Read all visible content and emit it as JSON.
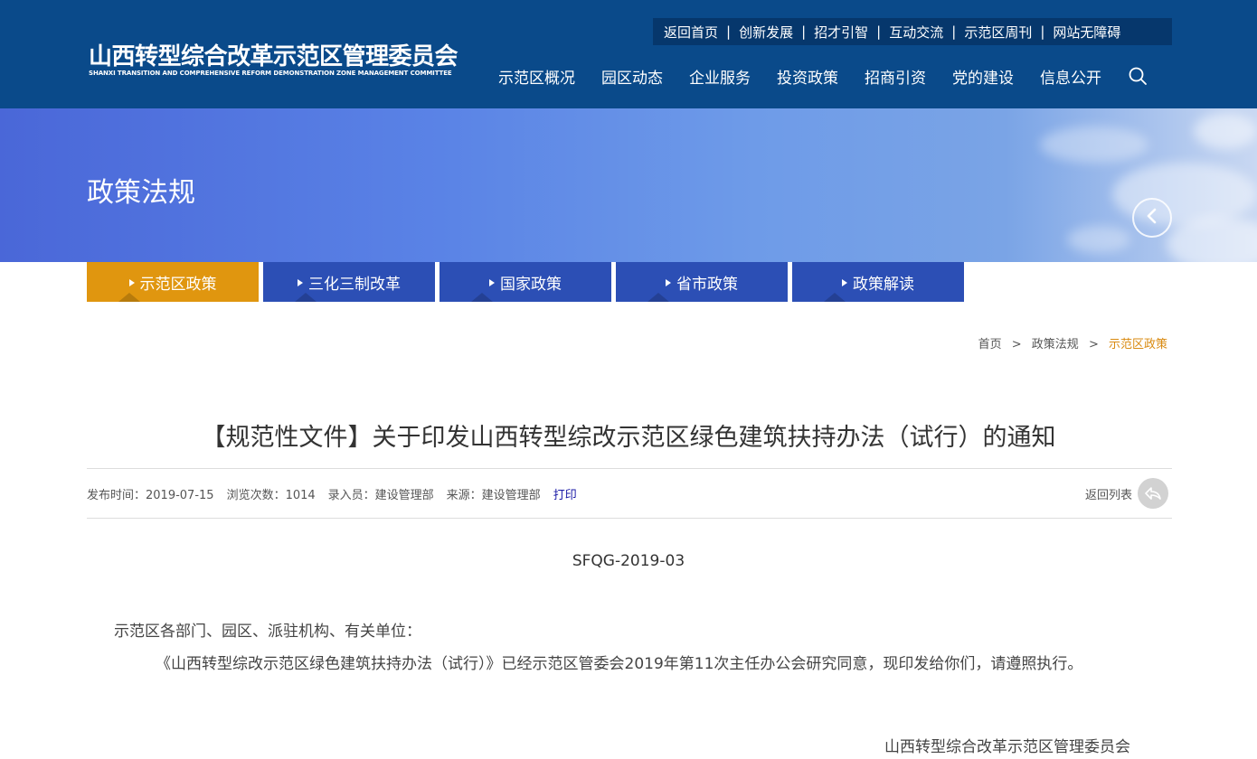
{
  "header": {
    "logo_cn": "山西转型综合改革示范区管理委员会",
    "logo_en": "SHANXI TRANSITION AND COMPREHENSIVE REFORM DEMONSTRATION ZONE MANAGEMENT COMMITTEE",
    "top_links": [
      "返回首页",
      "创新发展",
      "招才引智",
      "互动交流",
      "示范区周刊",
      "网站无障碍"
    ],
    "top_sep": "|",
    "nav": [
      "示范区概况",
      "园区动态",
      "企业服务",
      "投资政策",
      "招商引资",
      "党的建设",
      "信息公开"
    ],
    "search_icon": "search-icon"
  },
  "banner": {
    "title": "政策法规",
    "prev_icon": "chevron-left-icon"
  },
  "tabs": [
    {
      "label": "示范区政策",
      "active": true
    },
    {
      "label": "三化三制改革",
      "active": false
    },
    {
      "label": "国家政策",
      "active": false
    },
    {
      "label": "省市政策",
      "active": false
    },
    {
      "label": "政策解读",
      "active": false
    }
  ],
  "breadcrumb": {
    "home": "首页",
    "sep": ">",
    "section": "政策法规",
    "current": "示范区政策"
  },
  "article": {
    "title": "【规范性文件】关于印发山西转型综改示范区绿色建筑扶持办法（试行）的通知",
    "meta": {
      "publish": "发布时间：2019-07-15",
      "views": "浏览次数：1014",
      "editor": "录入员：建设管理部",
      "source": "来源：建设管理部",
      "print": "打印"
    },
    "back_list": "返回列表",
    "doc_no": "SFQG-2019-03",
    "greeting": "示范区各部门、园区、派驻机构、有关单位：",
    "body": "《山西转型综改示范区绿色建筑扶持办法（试行）》已经示范区管委会2019年第11次主任办公会研究同意，现印发给你们，请遵照执行。",
    "signature": "山西转型综合改革示范区管理委员会"
  },
  "colors": {
    "header_bg": "#0a4a8a",
    "tab_active": "#e0960f",
    "tab_inactive": "#2c4fb5",
    "breadcrumb_current": "#d98a10",
    "print_link": "#1a1aa6"
  }
}
